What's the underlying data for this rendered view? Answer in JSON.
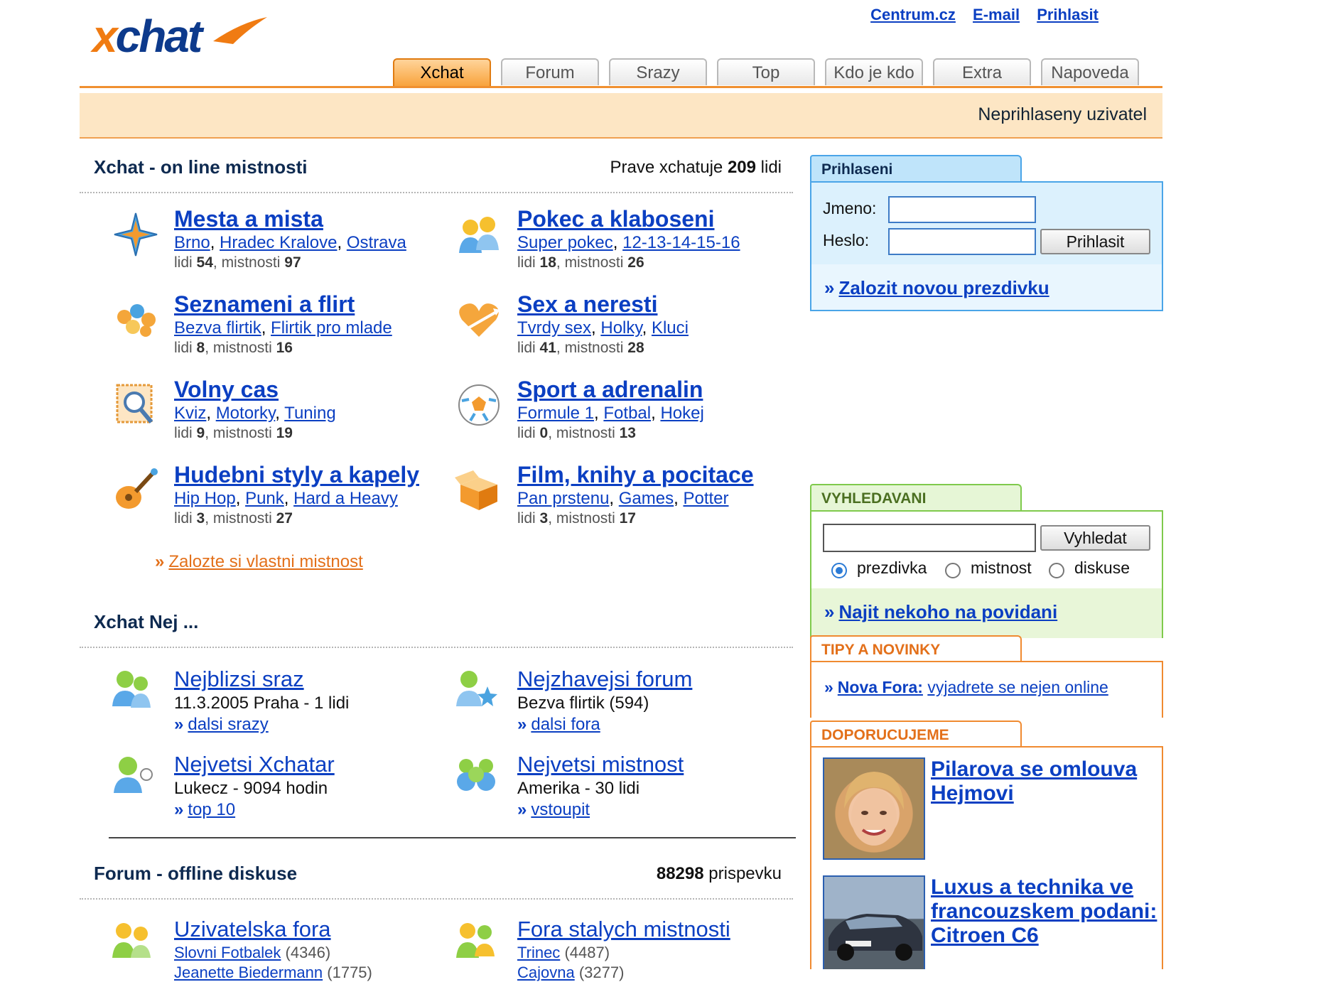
{
  "header": {
    "logo": "xchat",
    "links": [
      "Centrum.cz",
      "E-mail",
      "Prihlasit"
    ],
    "tabs": [
      "Xchat",
      "Forum",
      "Srazy",
      "Top",
      "Kdo je kdo",
      "Extra",
      "Napoveda"
    ],
    "status": "Neprihlaseny uzivatel"
  },
  "online": {
    "title": "Xchat - on line mistnosti",
    "count_prefix": "Prave xchatuje",
    "count": "209",
    "count_suffix": "lidi",
    "categories": [
      {
        "icon": "compass-star-icon",
        "title": "Mesta a mista",
        "subs": [
          "Brno",
          "Hradec Kralove",
          "Ostrava"
        ],
        "lidi": "54",
        "mistnosti": "97"
      },
      {
        "icon": "chatting-people-icon",
        "title": "Pokec a klaboseni",
        "subs": [
          "Super pokec",
          "12-13-14-15-16"
        ],
        "lidi": "18",
        "mistnosti": "26"
      },
      {
        "icon": "flowers-icon",
        "title": "Seznameni a flirt",
        "subs": [
          "Bezva flirtik",
          "Flirtik pro mlade"
        ],
        "lidi": "8",
        "mistnosti": "16"
      },
      {
        "icon": "heart-arrow-icon",
        "title": "Sex a neresti",
        "subs": [
          "Tvrdy sex",
          "Holky",
          "Kluci"
        ],
        "lidi": "41",
        "mistnosti": "28"
      },
      {
        "icon": "magnifier-stamp-icon",
        "title": "Volny cas",
        "subs": [
          "Kviz",
          "Motorky",
          "Tuning"
        ],
        "lidi": "9",
        "mistnosti": "19"
      },
      {
        "icon": "soccer-ball-icon",
        "title": "Sport a adrenalin",
        "subs": [
          "Formule 1",
          "Fotbal",
          "Hokej"
        ],
        "lidi": "0",
        "mistnosti": "13"
      },
      {
        "icon": "guitar-icon",
        "title": "Hudebni styly a kapely",
        "subs": [
          "Hip Hop",
          "Punk",
          "Hard a Heavy"
        ],
        "lidi": "3",
        "mistnosti": "27"
      },
      {
        "icon": "open-box-icon",
        "title": "Film, knihy a pocitace",
        "subs": [
          "Pan prstenu",
          "Games",
          "Potter"
        ],
        "lidi": "3",
        "mistnosti": "17"
      }
    ],
    "lidi_label": "lidi",
    "mistnosti_label": "mistnosti",
    "create_room": "Zalozte si vlastni mistnost"
  },
  "nej": {
    "title": "Xchat Nej ...",
    "items": [
      {
        "icon": "meeting-people-icon",
        "title": "Nejblizsi sraz",
        "line": "11.3.2005 Praha - 1 lidi",
        "more": "dalsi srazy"
      },
      {
        "icon": "forum-star-icon",
        "title": "Nejzhavejsi forum",
        "line": "Bezva flirtik (594)",
        "more": "dalsi fora"
      },
      {
        "icon": "user-chat-icon",
        "title": "Nejvetsi Xchatar",
        "line": "Lukecz - 9094 hodin",
        "more": "top 10"
      },
      {
        "icon": "group-icon",
        "title": "Nejvetsi mistnost",
        "line": "Amerika - 30 lidi",
        "more": "vstoupit"
      }
    ]
  },
  "forum": {
    "title": "Forum - offline diskuse",
    "count": "88298",
    "count_suffix": "prispevku",
    "cols": [
      {
        "icon": "forum-users-icon",
        "title": "Uzivatelska fora",
        "rows": [
          {
            "name": "Slovni Fotbalek",
            "count": "(4346)"
          },
          {
            "name": "Jeanette Biedermann",
            "count": "(1775)"
          }
        ]
      },
      {
        "icon": "forum-rooms-icon",
        "title": "Fora stalych mistnosti",
        "rows": [
          {
            "name": "Trinec",
            "count": "(4487)"
          },
          {
            "name": "Cajovna",
            "count": "(3277)"
          }
        ]
      }
    ]
  },
  "login": {
    "tab": "Prihlaseni",
    "name_label": "Jmeno:",
    "pass_label": "Heslo:",
    "button": "Prihlasit",
    "register": "Zalozit novou prezdivku"
  },
  "search": {
    "tab": "VYHLEDAVANI",
    "button": "Vyhledat",
    "options": [
      "prezdivka",
      "mistnost",
      "diskuse"
    ],
    "selected": "prezdivka",
    "find": "Najit nekoho na povidani"
  },
  "tips": {
    "tab": "TIPY A NOVINKY",
    "bold": "Nova Fora:",
    "text": "vyjadrete se nejen online"
  },
  "recommend": {
    "tab": "DOPORUCUJEME",
    "items": [
      {
        "title": "Pilarova se omlouva Hejmovi"
      },
      {
        "title": "Luxus a technika ve francouzskem podani: Citroen C6"
      }
    ]
  },
  "colors": {
    "orange": "#f09030",
    "blue_link": "#0b3fc2",
    "login_blue": "#4aa5e8",
    "search_green": "#7fca4c"
  }
}
